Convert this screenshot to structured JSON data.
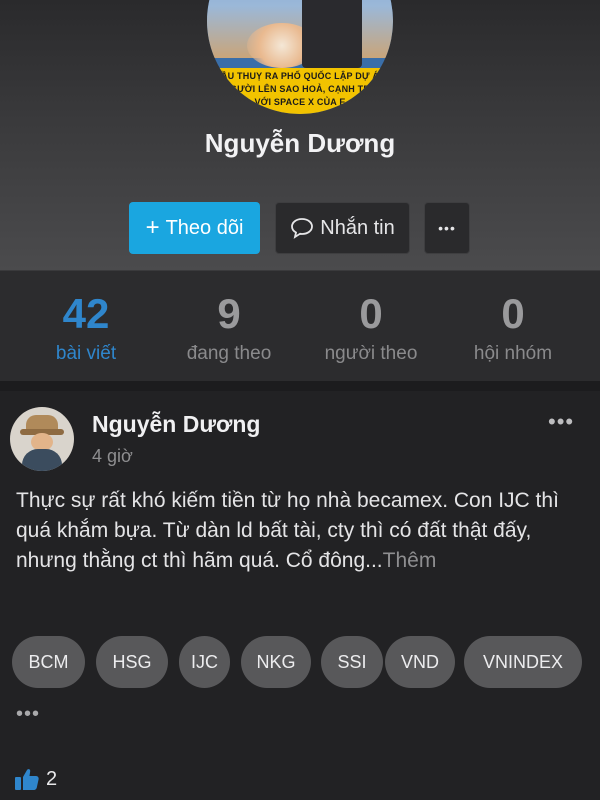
{
  "profile": {
    "name": "Nguyễn Dương",
    "avatar_banner": "BẦU THUỴ RA PHỐ QUỐC LẬP DỰ ÁN\nNGƯỜI LÊN SAO HOẢ, CẠNH TRA\nVỚI SPACE X CỦA E"
  },
  "actions": {
    "follow_label": "Theo dõi",
    "message_label": "Nhắn tin",
    "more_label": "•••"
  },
  "stats": [
    {
      "value": "42",
      "label": "bài viết"
    },
    {
      "value": "9",
      "label": "đang theo"
    },
    {
      "value": "0",
      "label": "người theo"
    },
    {
      "value": "0",
      "label": "hội nhóm"
    }
  ],
  "post": {
    "author": "Nguyễn Dương",
    "time": "4 giờ",
    "menu_label": "•••",
    "text": "Thực sự rất khó kiếm tiền từ họ nhà becamex. Con IJC thì quá khắm bựa. Từ dàn ld bất tài, cty thì có đất thật đấy, nhưng thằng ct thì hãm quá. Cổ đông...",
    "more_link": "Thêm",
    "tags": [
      "BCM",
      "HSG",
      "IJC",
      "NKG",
      "SSI",
      "VND",
      "VNINDEX"
    ],
    "tags_more": "•••",
    "likes": "2"
  },
  "colors": {
    "accent": "#1aa6e0",
    "stat_active": "#2f86cc",
    "like_icon": "#2f86cc"
  }
}
